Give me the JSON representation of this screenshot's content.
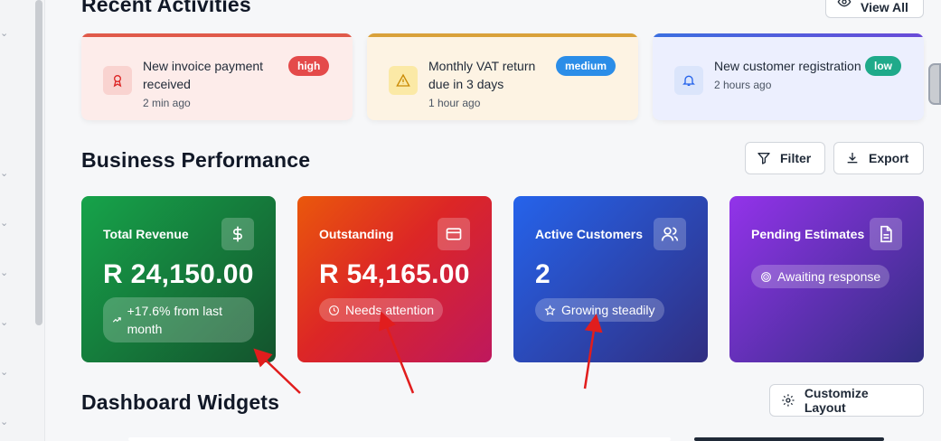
{
  "sections": {
    "recent_title": "Recent Activities",
    "view_all": "View All",
    "performance_title": "Business Performance",
    "filter": "Filter",
    "export": "Export",
    "widgets_title": "Dashboard Widgets",
    "customize": "Customize Layout"
  },
  "activities": [
    {
      "title": "New invoice payment received",
      "time": "2 min ago",
      "badge": "high",
      "icon": "award-icon",
      "color": "#e44a4a"
    },
    {
      "title": "Monthly VAT return due in 3 days",
      "time": "1 hour ago",
      "badge": "medium",
      "icon": "warning-icon",
      "color": "#2b8de8"
    },
    {
      "title": "New customer registration",
      "time": "2 hours ago",
      "badge": "low",
      "icon": "bell-icon",
      "color": "#1faa8a"
    }
  ],
  "stats": [
    {
      "label": "Total Revenue",
      "value": "R 24,150.00",
      "note": "+17.6% from last month",
      "icon": "dollar-icon"
    },
    {
      "label": "Outstanding",
      "value": "R 54,165.00",
      "note": "Needs attention",
      "icon": "card-icon"
    },
    {
      "label": "Active Customers",
      "value": "2",
      "note": "Growing steadily",
      "icon": "users-icon"
    },
    {
      "label": "Pending Estimates",
      "value": "",
      "note": "Awaiting response",
      "icon": "document-icon"
    }
  ],
  "colors": {
    "revenue": "#16a34a",
    "outstanding": "#dc2626",
    "customers": "#1d4ed8",
    "estimates": "#7e22ce",
    "annotation_arrow": "#e11d1d"
  }
}
